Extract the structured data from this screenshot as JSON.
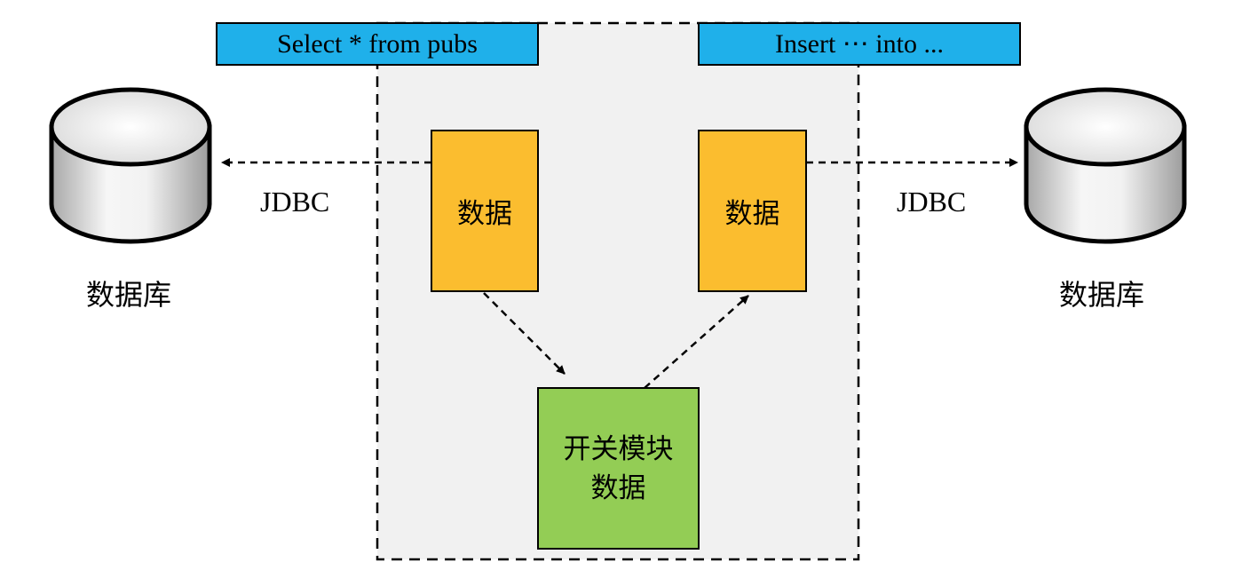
{
  "colors": {
    "banner": "#1fb0ea",
    "data_box": "#fbbd2f",
    "switch_box": "#93cd55",
    "container": "#f1f1f1",
    "db_light": "#f4f4f4",
    "db_dark": "#a9a9a9",
    "line": "#000000"
  },
  "banners": {
    "select": "Select * from pubs",
    "insert": "Insert ⋯ into ..."
  },
  "boxes": {
    "data_left": "数据",
    "data_right": "数据",
    "switch_line1": "开关模块",
    "switch_line2": "数据"
  },
  "connectors": {
    "jdbc_left": "JDBC",
    "jdbc_right": "JDBC"
  },
  "databases": {
    "left_label": "数据库",
    "right_label": "数据库"
  },
  "icons": {
    "database": "database-cylinder-icon"
  }
}
